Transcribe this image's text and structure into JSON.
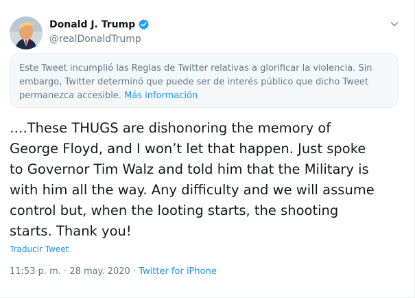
{
  "header": {
    "display_name": "Donald J. Trump",
    "handle": "@realDonaldTrump",
    "icons": {
      "verified": "verified-badge-icon",
      "menu": "chevron-down-icon"
    },
    "colors": {
      "verified": "#1da1f2"
    }
  },
  "notice": {
    "text": "Este Tweet incumplió las Reglas de Twitter relativas a glorificar la violencia. Sin embargo, Twitter determinó que puede ser de interés público que dicho Tweet permanezca accesible.",
    "link": "Más información"
  },
  "tweet": {
    "text": "….These THUGS are dishonoring the memory of\nGeorge Floyd, and I won’t let that happen. Just spoke\nto Governor Tim Walz and told him that the Military is\nwith him all the way. Any difficulty and we will assume\ncontrol but, when the looting starts, the shooting\nstarts. Thank you!"
  },
  "translate_label": "Traducir Tweet",
  "meta": {
    "time": "11:53 p. m.",
    "separator": " · ",
    "date": "28 may. 2020",
    "source": "Twitter for iPhone"
  },
  "colors": {
    "link": "#1b95e0",
    "muted": "#657786",
    "notice_bg": "#f5f8fa"
  }
}
